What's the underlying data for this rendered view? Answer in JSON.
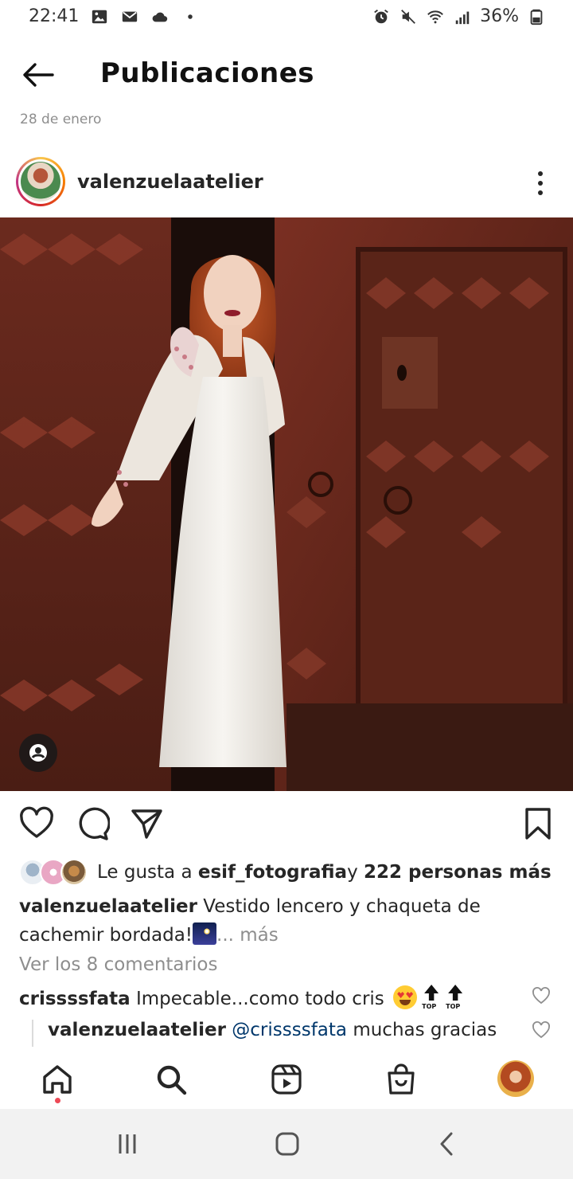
{
  "status_bar": {
    "time": "22:41",
    "battery": "36%",
    "left_icons": [
      "gallery-icon",
      "mail-icon",
      "cloud-icon",
      "dot-icon"
    ],
    "right_icons": [
      "alarm-icon",
      "mute-icon",
      "wifi-icon",
      "signal-icon",
      "battery-icon"
    ]
  },
  "header": {
    "title": "Publicaciones",
    "back_icon": "arrow-left-icon"
  },
  "post": {
    "date": "28 de enero",
    "username": "valenzuelaatelier",
    "likes": {
      "prefix": "Le gusta a ",
      "user": "esif_fotografia",
      "middle": " y ",
      "others": "222 personas más"
    },
    "caption": {
      "user": "valenzuelaatelier",
      "text": " Vestido lencero y chaqueta de cachemir bordada!",
      "ellipsis": "... ",
      "more": "más"
    },
    "view_comments": "Ver los 8 comentarios",
    "comments": [
      {
        "user": "crissssfata",
        "text": " Impecable...como todo cris "
      },
      {
        "user": "valenzuelaatelier",
        "mention": "@crissssfata",
        "text": " muchas gracias"
      }
    ],
    "top_label": "TOP"
  },
  "bottom_nav": {
    "items": [
      "home-icon",
      "search-icon",
      "reels-icon",
      "shop-icon",
      "profile-avatar"
    ]
  },
  "colors": {
    "text": "#262626",
    "muted": "#8e8e8e",
    "mention": "#00376b",
    "notification_dot": "#ed4956"
  }
}
